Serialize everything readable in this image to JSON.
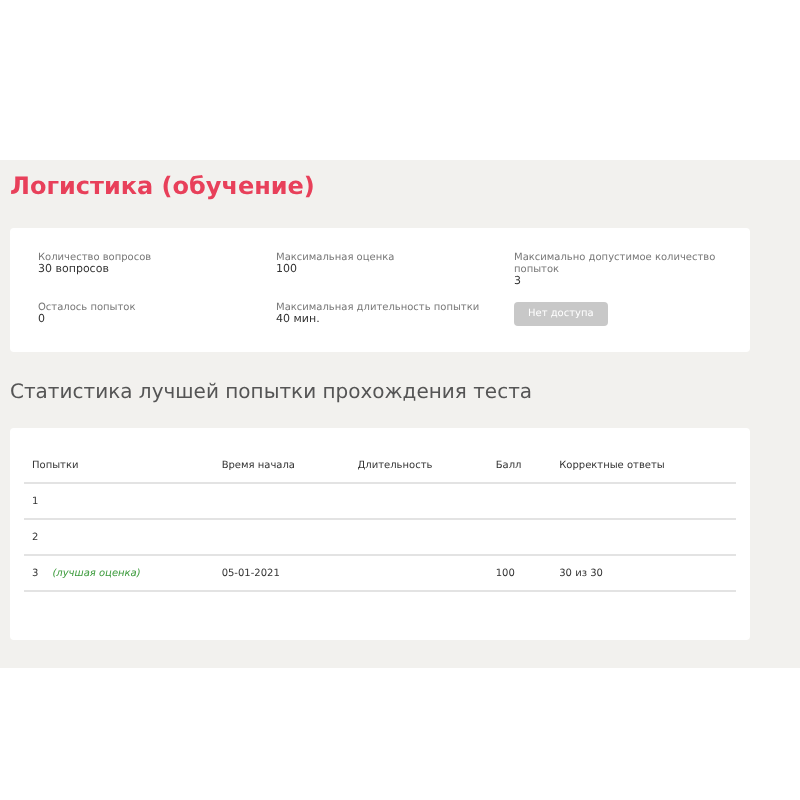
{
  "title": "Логистика (обучение)",
  "info": [
    {
      "label": "Количество вопросов",
      "value": "30 вопросов"
    },
    {
      "label": "Максимальная оценка",
      "value": "100"
    },
    {
      "label": "Максимально допустимое количество попыток",
      "value": "3"
    },
    {
      "label": "Осталось попыток",
      "value": "0"
    },
    {
      "label": "Максимальная длительность попытки",
      "value": "40 мин."
    }
  ],
  "access_button": {
    "label": "Нет доступа",
    "disabled": true
  },
  "section_title": "Статистика лучшей попытки прохождения теста",
  "table": {
    "columns": [
      "Попытки",
      "Время начала",
      "Длительность",
      "Балл",
      "Корректные ответы"
    ],
    "rows": [
      {
        "cells": [
          "1",
          "",
          "",
          "",
          ""
        ]
      },
      {
        "cells": [
          "2",
          "",
          "",
          "",
          ""
        ]
      },
      {
        "best_label": "(лучшая оценка)",
        "cells": [
          "3",
          "05-01-2021",
          "",
          "100",
          "30 из 30"
        ]
      }
    ]
  }
}
